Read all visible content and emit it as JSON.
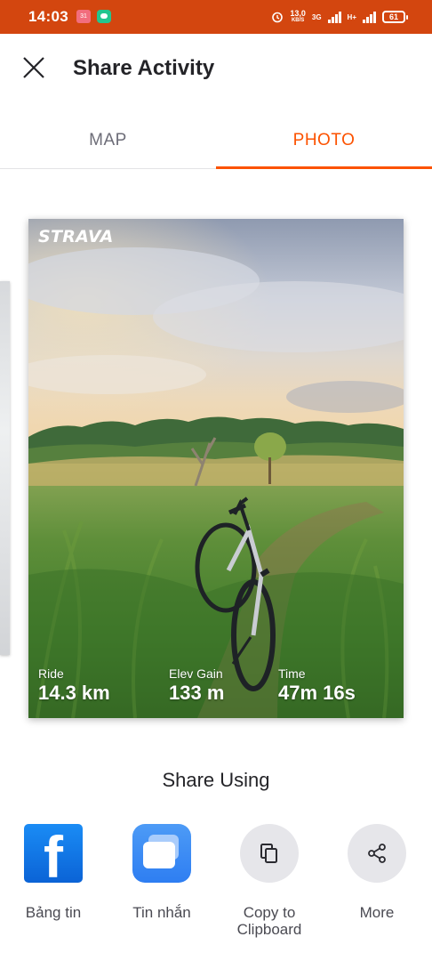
{
  "status_bar": {
    "time": "14:03",
    "calendar_badge": "31",
    "net_speed": "13,0",
    "net_speed_unit": "KB/S",
    "network_1": "3G",
    "network_2": "H+",
    "battery": "61"
  },
  "header": {
    "title": "Share Activity",
    "close_icon": "close-icon"
  },
  "tabs": [
    {
      "label": "MAP",
      "selected": false
    },
    {
      "label": "PHOTO",
      "selected": true
    }
  ],
  "card": {
    "logo": "STRAVA",
    "stats": [
      {
        "label": "Ride",
        "value": "14.3 km"
      },
      {
        "label": "Elev Gain",
        "value": "133 m"
      },
      {
        "label": "Time",
        "value": "47m 16s"
      }
    ]
  },
  "share": {
    "title": "Share Using",
    "targets": [
      {
        "label": "Bảng tin",
        "icon": "facebook-icon"
      },
      {
        "label": "Tin nhắn",
        "icon": "messages-icon"
      },
      {
        "label": "Copy to Clipboard",
        "icon": "copy-icon"
      },
      {
        "label": "More",
        "icon": "share-icon"
      }
    ]
  },
  "colors": {
    "status_bar": "#d3460f",
    "accent": "#fc5200",
    "facebook": "#1877f2"
  }
}
